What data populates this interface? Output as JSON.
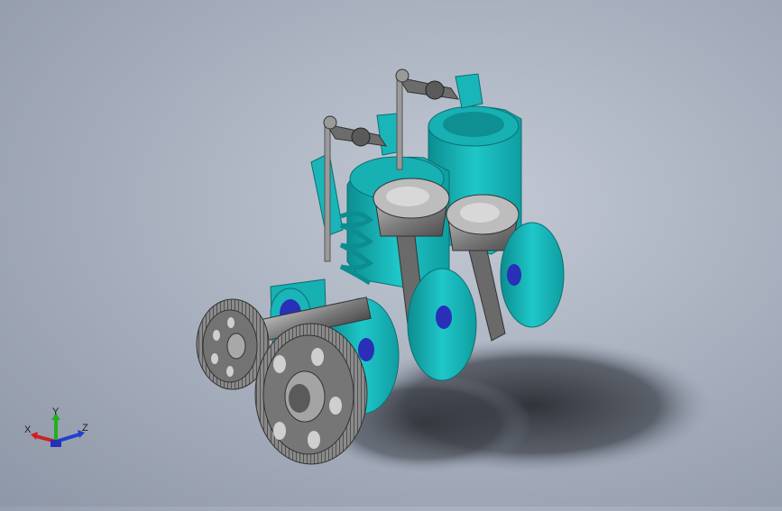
{
  "viewport": {
    "background_top": "#c3c9d4",
    "background_bottom": "#8e97a7",
    "model_color": "#1ab5b8",
    "model_shade": "#0d8d90",
    "metal_color": "#8c8c8c",
    "bearing_color": "#2a2fb8"
  },
  "triad": {
    "x_label": "X",
    "y_label": "Y",
    "z_label": "Z",
    "x_color": "#d02020",
    "y_color": "#20b020",
    "z_color": "#2040d0"
  }
}
